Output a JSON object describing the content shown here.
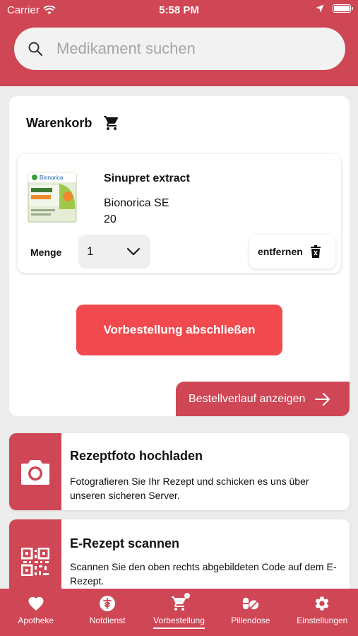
{
  "status_bar": {
    "carrier": "Carrier",
    "time": "5:58 PM"
  },
  "search": {
    "placeholder": "Medikament suchen",
    "value": ""
  },
  "cart": {
    "title": "Warenkorb",
    "item": {
      "name": "Sinupret extract",
      "manufacturer": "Bionorica SE",
      "pack_size": "20",
      "image_brand": "Bionorica",
      "quantity_label": "Menge",
      "quantity_value": "1",
      "remove_label": "entfernen"
    },
    "checkout_label": "Vorbestellung abschließen",
    "history_label": "Bestellverlauf anzeigen"
  },
  "features": [
    {
      "title": "Rezeptfoto hochladen",
      "description": "Fotografieren Sie Ihr Rezept und schicken es uns über unseren sicheren Server.",
      "icon": "camera-icon"
    },
    {
      "title": "E-Rezept scannen",
      "description": "Scannen Sie den oben rechts abgebildeten Code auf dem E-Rezept.",
      "icon": "qr-code-icon"
    }
  ],
  "tabs": [
    {
      "label": "Apotheke",
      "icon": "heart-icon",
      "active": false
    },
    {
      "label": "Notdienst",
      "icon": "emergency-icon",
      "active": false
    },
    {
      "label": "Vorbestellung",
      "icon": "cart-icon",
      "active": true,
      "badge": true
    },
    {
      "label": "Pillendose",
      "icon": "pills-icon",
      "active": false
    },
    {
      "label": "Einstellungen",
      "icon": "gear-icon",
      "active": false
    }
  ],
  "colors": {
    "brand": "#cf4655",
    "checkout": "#f04a4e",
    "background": "#ececec"
  }
}
